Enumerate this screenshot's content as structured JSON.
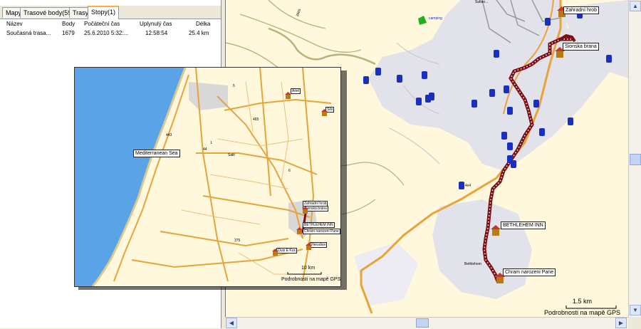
{
  "tabs": [
    {
      "label": "Mapy"
    },
    {
      "label": "Trasové body(59)"
    },
    {
      "label": "Trasy"
    },
    {
      "label": "Stopy(1)",
      "active": true
    }
  ],
  "track_list": {
    "columns": [
      "Název",
      "Body",
      "Počáteční čas",
      "Uplynulý čas",
      "Délka"
    ],
    "rows": [
      [
        "Současná trasa...",
        "1679",
        "25.6.2010 5:32:...",
        "12:58:54",
        "25.4 km"
      ]
    ]
  },
  "main_map": {
    "labels": {
      "zahradni_hrob": "Zahradní hrob",
      "sionska_brana": "Sionska brana",
      "bethlehem_inn": "BETHLEHEM INN",
      "chram": "Chram narozeni Pane",
      "camping": "camping",
      "road_3965": "3965",
      "fourx4": "4x4",
      "bethlehem": "Bethlehem",
      "top_label": "Sultan..."
    },
    "scale": "1.5 km",
    "credit": "Podrobnosti na mapě GPS",
    "colors": {
      "track": "#7a1016",
      "road": "#e8a33a",
      "urban": "#e0e0e8",
      "fuel": "#1a2fbf",
      "bg": "#fff8dc"
    }
  },
  "inset_map": {
    "labels": {
      "mediterranean": "Mediterranean Sea",
      "zahradni_hrob": "Zahradní hrob",
      "sionska_brana": "Sionská brána",
      "bethlehem_inn": "BETHLEHEM INN",
      "chram": "Chram narozeni Pane",
      "herodion": "Herodion",
      "ouis_e_kox": "Ouis E Kox",
      "shilo": "Šilo",
      "ariel": "Ariel",
      "salit": "Salit",
      "road_443": "443",
      "road_1": "1",
      "road_6": "6",
      "road_44": "44",
      "road_465": "465",
      "road_375": "375",
      "road_5": "5"
    },
    "scale": "10 km",
    "credit": "Podrobnosti na mapě GPS"
  }
}
